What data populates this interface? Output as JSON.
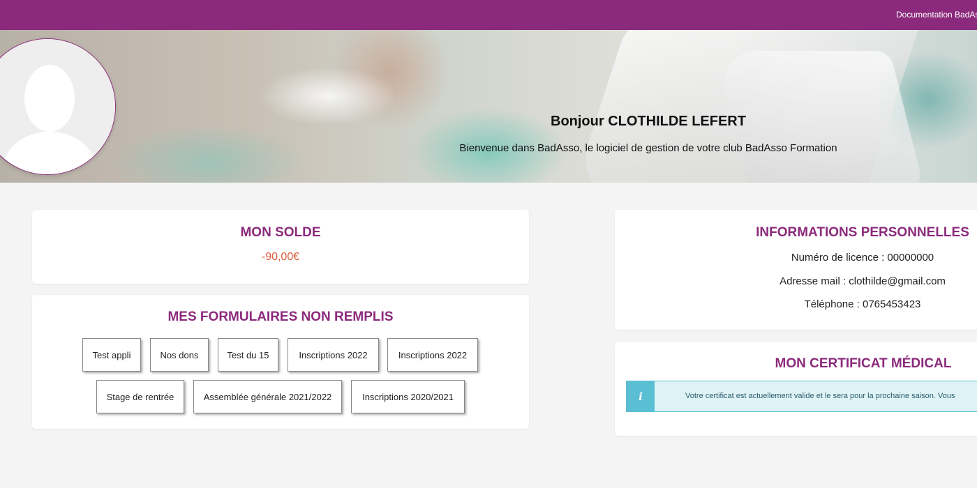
{
  "topbar": {
    "doc_link": "Documentation BadAsso",
    "color": "#8b2a7c"
  },
  "hero": {
    "greeting": "Bonjour CLOTHILDE LEFERT",
    "welcome": "Bienvenue dans BadAsso, le logiciel de gestion de votre club BadAsso Formation",
    "avatar_icon": "user-placeholder-icon"
  },
  "balance_card": {
    "title": "MON SOLDE",
    "amount": "-90,00€",
    "amount_color": "#e05a3a"
  },
  "forms_card": {
    "title": "MES FORMULAIRES NON REMPLIS",
    "forms": [
      "Test appli",
      "Nos dons",
      "Test du 15",
      "Inscriptions 2022",
      "Inscriptions 2022",
      "Stage de rentrée",
      "Assemblée générale 2021/2022",
      "Inscriptions 2020/2021"
    ]
  },
  "personal_card": {
    "title": "INFORMATIONS PERSONNELLES",
    "licence": "Numéro de licence : 00000000",
    "email": "Adresse mail : clothilde@gmail.com",
    "phone": "Téléphone : 0765453423"
  },
  "certificate_card": {
    "title": "MON CERTIFICAT MÉDICAL",
    "alert_icon": "info-icon",
    "alert_text": "Votre certificat est actuellement valide et le sera pour la prochaine saison. Vous"
  },
  "accent_color": "#8b2a7c"
}
